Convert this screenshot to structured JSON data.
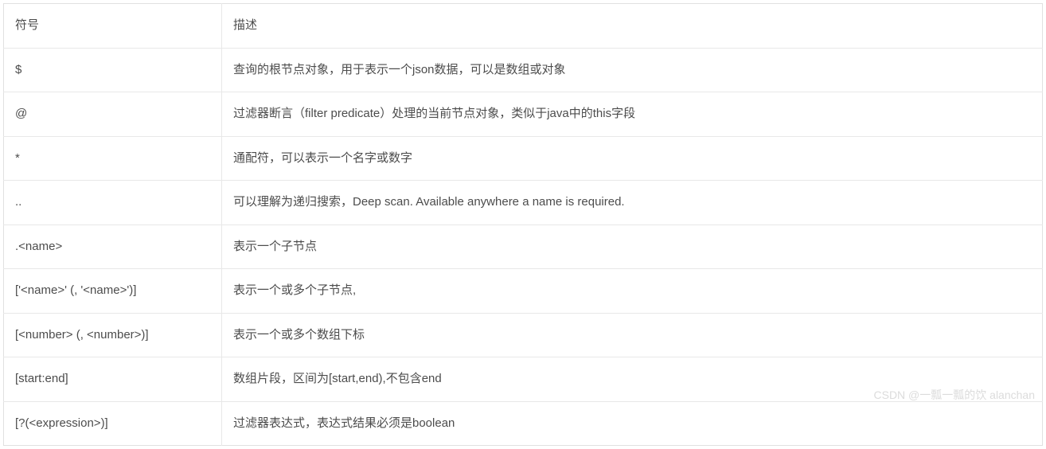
{
  "table": {
    "header": {
      "symbol": "符号",
      "description": "描述"
    },
    "rows": [
      {
        "symbol": "$",
        "description": "查询的根节点对象，用于表示一个json数据，可以是数组或对象"
      },
      {
        "symbol": "@",
        "description": "过滤器断言（filter predicate）处理的当前节点对象，类似于java中的this字段"
      },
      {
        "symbol": "*",
        "description": "通配符，可以表示一个名字或数字"
      },
      {
        "symbol": "..",
        "description": "可以理解为递归搜索，Deep scan. Available anywhere a name is required."
      },
      {
        "symbol": ".<name>",
        "description": "表示一个子节点"
      },
      {
        "symbol": "['<name>' (, '<name>')]",
        "description": "表示一个或多个子节点,"
      },
      {
        "symbol": "[<number> (, <number>)]",
        "description": "表示一个或多个数组下标"
      },
      {
        "symbol": "[start:end]",
        "description": "数组片段，区间为[start,end),不包含end"
      },
      {
        "symbol": "[?(<expression>)]",
        "description": "过滤器表达式，表达式结果必须是boolean"
      }
    ]
  },
  "watermark": "CSDN @一瓢一瓢的饮 alanchan"
}
